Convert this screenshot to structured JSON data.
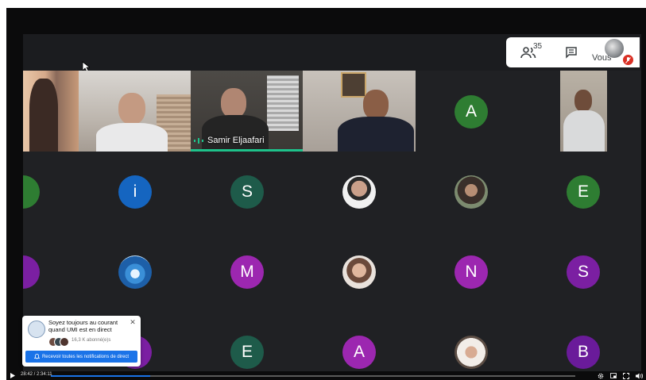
{
  "meet": {
    "people_count": "35",
    "you_label": "Vous",
    "speaker_name": "Samir Eljaafari"
  },
  "grid": {
    "row2": [
      "",
      "i",
      "S",
      "",
      "",
      "E"
    ],
    "row3": [
      "",
      "",
      "M",
      "",
      "N",
      "S"
    ],
    "row4": [
      "",
      "",
      "E",
      "A",
      "",
      "B"
    ],
    "row1_letter": "A"
  },
  "colors": {
    "green": "#2e7d32",
    "teal": "#1e5b4a",
    "blue": "#1565c0",
    "purple": "#7b1fa2",
    "magenta": "#9c27b0",
    "speaking": "#1ec28b",
    "accent": "#1a73e8"
  },
  "notification": {
    "title": "Soyez toujours au courant quand UMI est en direct",
    "subscribers": "16,3 K abonné(e)s",
    "button_label": "Recevoir toutes les notifications de direct"
  },
  "player": {
    "time": "28:42 / 2:34:11",
    "progress": 0.19
  }
}
